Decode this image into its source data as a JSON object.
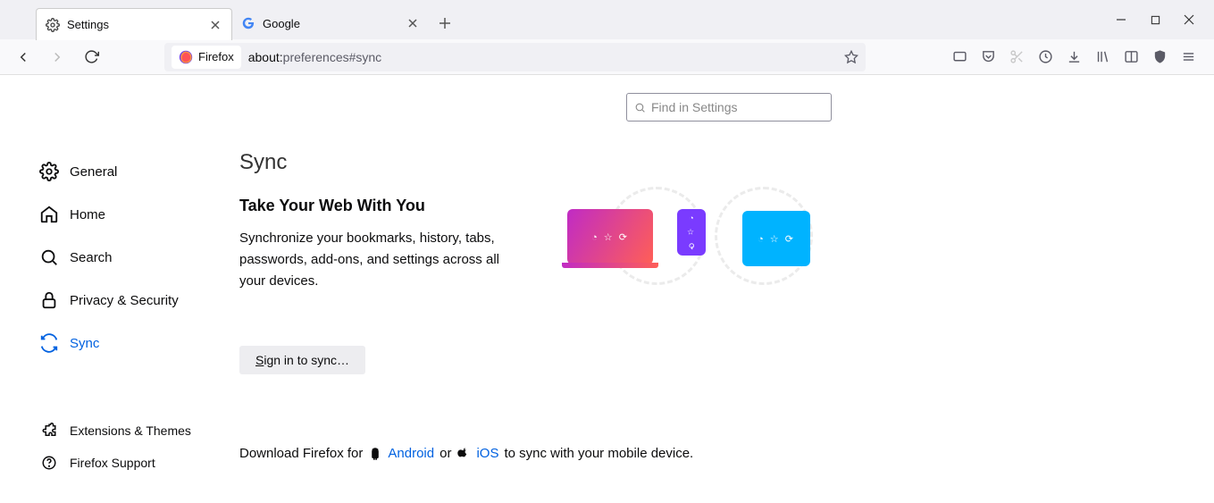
{
  "window": {
    "min": "—",
    "max": "□",
    "close": "✕"
  },
  "tabs": [
    {
      "title": "Settings",
      "active": true
    },
    {
      "title": "Google",
      "active": false
    }
  ],
  "url": {
    "identity": "Firefox",
    "prefix": "about:",
    "path": "preferences#sync"
  },
  "search": {
    "placeholder": "Find in Settings"
  },
  "sidebar": {
    "items": [
      {
        "label": "General"
      },
      {
        "label": "Home"
      },
      {
        "label": "Search"
      },
      {
        "label": "Privacy & Security"
      },
      {
        "label": "Sync"
      }
    ],
    "bottom": [
      {
        "label": "Extensions & Themes"
      },
      {
        "label": "Firefox Support"
      }
    ]
  },
  "main": {
    "h1": "Sync",
    "h2": "Take Your Web With You",
    "desc": "Synchronize your bookmarks, history, tabs, passwords, add-ons, and settings across all your devices.",
    "signin_pre": "S",
    "signin_post": "ign in to sync…",
    "dl_pre": "Download Firefox for",
    "dl_android": "Android",
    "dl_or": "or",
    "dl_ios": "iOS",
    "dl_post": "to sync with your mobile device."
  },
  "icons": {
    "devglyphs": "◔ ☆ ⟳"
  }
}
